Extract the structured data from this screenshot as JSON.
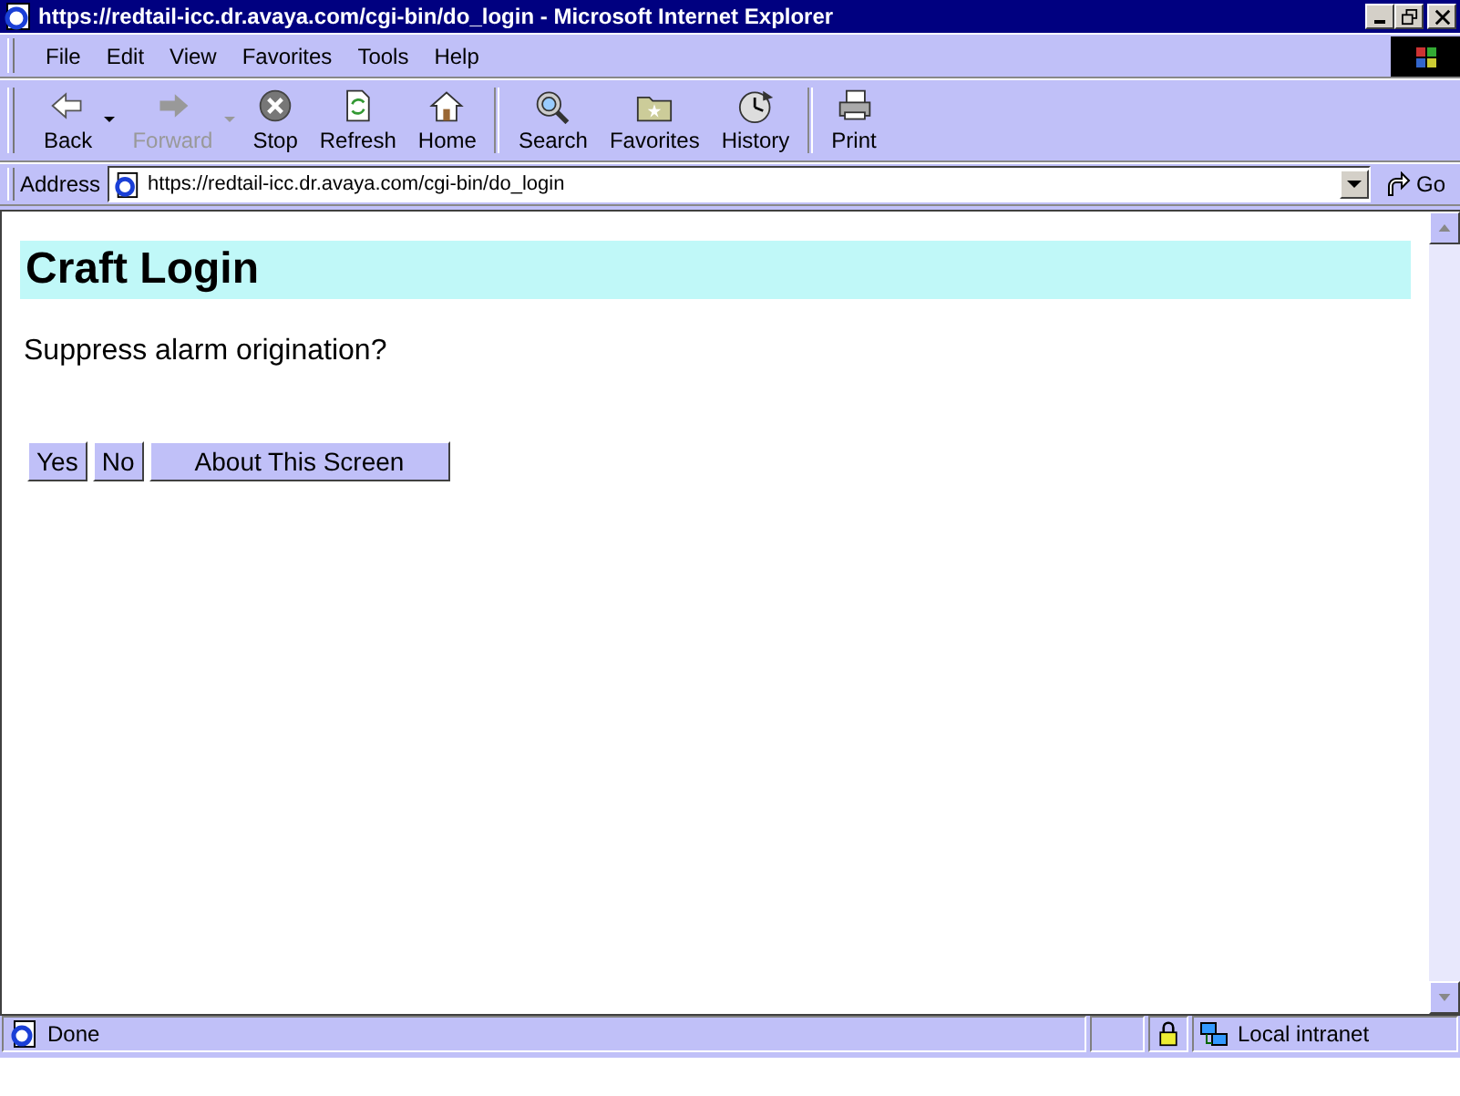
{
  "window": {
    "title": "https://redtail-icc.dr.avaya.com/cgi-bin/do_login - Microsoft Internet Explorer"
  },
  "menu": [
    "File",
    "Edit",
    "View",
    "Favorites",
    "Tools",
    "Help"
  ],
  "toolbar": [
    {
      "label": "Back",
      "disabled": false
    },
    {
      "label": "Forward",
      "disabled": true
    },
    {
      "label": "Stop",
      "disabled": false
    },
    {
      "label": "Refresh",
      "disabled": false
    },
    {
      "label": "Home",
      "disabled": false
    },
    {
      "label": "Search",
      "disabled": false
    },
    {
      "label": "Favorites",
      "disabled": false
    },
    {
      "label": "History",
      "disabled": false
    },
    {
      "label": "Print",
      "disabled": false
    }
  ],
  "address": {
    "label": "Address",
    "value": "https://redtail-icc.dr.avaya.com/cgi-bin/do_login",
    "go": "Go"
  },
  "page": {
    "heading": "Craft Login",
    "question": "Suppress alarm origination?",
    "buttons": [
      "Yes",
      "No",
      "About This Screen"
    ]
  },
  "status_bar": {
    "text": "Done",
    "zone": "Local intranet"
  }
}
